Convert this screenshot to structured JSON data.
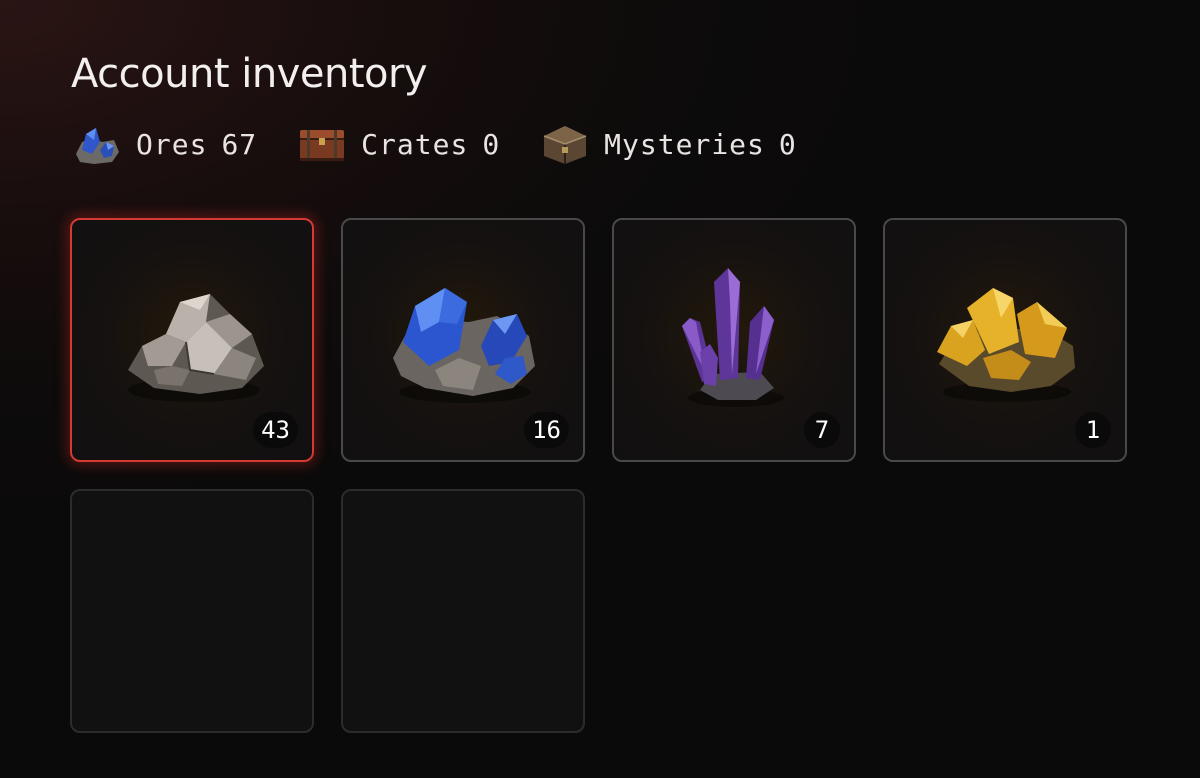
{
  "inventory": {
    "title": "Account inventory",
    "summary": [
      {
        "icon": "blue-ore-icon",
        "label": "Ores",
        "count": "67"
      },
      {
        "icon": "crate-icon",
        "label": "Crates",
        "count": "0"
      },
      {
        "icon": "mystery-chest-icon",
        "label": "Mysteries",
        "count": "0"
      }
    ],
    "slots": [
      {
        "icon": "stone-ore-icon",
        "quantity": "43",
        "selected": true
      },
      {
        "icon": "sapphire-ore-icon",
        "quantity": "16",
        "selected": false
      },
      {
        "icon": "amethyst-crystal-icon",
        "quantity": "7",
        "selected": false
      },
      {
        "icon": "gold-ore-icon",
        "quantity": "1",
        "selected": false
      },
      {
        "empty": true
      },
      {
        "empty": true
      }
    ]
  },
  "colors": {
    "selected_border": "#d23a32",
    "slot_border": "#4a4949",
    "background": "#0b0a0a"
  }
}
